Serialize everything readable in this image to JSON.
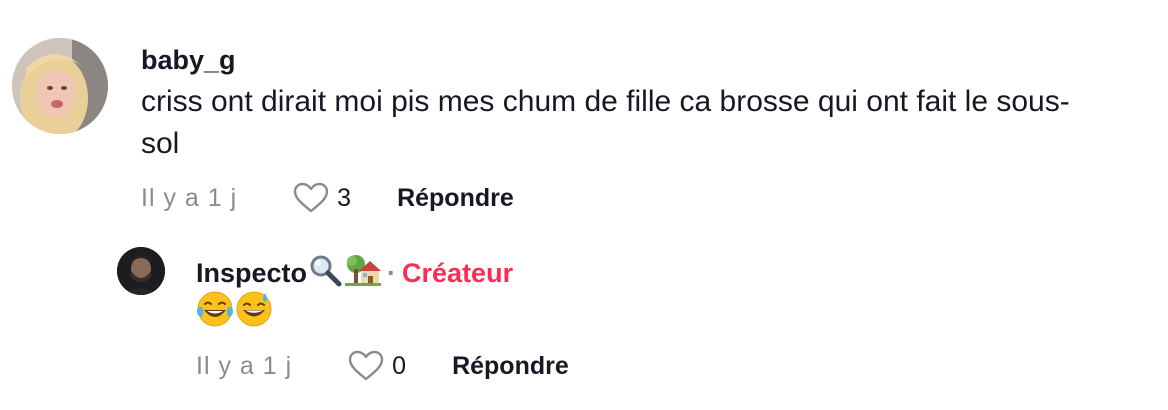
{
  "comment": {
    "username": "baby_g",
    "text": "criss ont dirait moi pis mes chum de fille ca brosse qui ont fait le sous-sol",
    "time": "Il y a 1 j",
    "likes": "3",
    "reply_label": "Répondre"
  },
  "reply": {
    "username": "Inspecto",
    "username_icons": [
      "magnifier-icon",
      "house-tree-icon"
    ],
    "separator": "·",
    "creator_label": "Créateur",
    "text_icons": [
      "laughing-tears-emoji",
      "grinning-sweat-emoji"
    ],
    "time": "Il y a 1 j",
    "likes": "0",
    "reply_label": "Répondre"
  },
  "colors": {
    "text": "#161823",
    "muted": "#8a8b91",
    "creator": "#fe2c55"
  }
}
